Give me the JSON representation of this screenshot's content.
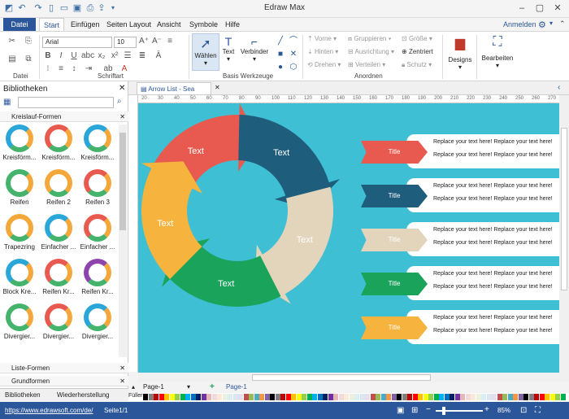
{
  "app": {
    "title": "Edraw Max"
  },
  "menu": {
    "tabs": [
      "Datei",
      "Start",
      "Einfügen",
      "Seiten Layout",
      "Ansicht",
      "Symbole",
      "Hilfe"
    ],
    "login": "Anmelden"
  },
  "ribbon": {
    "font_name": "Arial",
    "font_size": "10",
    "groups": {
      "file": "Datei",
      "font": "Schriftart",
      "tools": "Basis Werkzeuge",
      "arrange": "Anordnen"
    },
    "tools": {
      "select": "Wählen",
      "text": "Text",
      "connector": "Verbinder"
    },
    "arrange_items": [
      "Vorne",
      "Hinten",
      "Drehen",
      "Gruppieren",
      "Ausrichtung",
      "Verteilen",
      "Größe",
      "Zentriert",
      "Schutz"
    ],
    "designs": "Designs",
    "edit": "Bearbeiten"
  },
  "library": {
    "title": "Bibliotheken",
    "category1": "Kreislauf-Formen",
    "shapes": [
      {
        "label": "Kreisförm...",
        "color": "#2aa7d8"
      },
      {
        "label": "Kreisförm...",
        "color": "#e85a4f"
      },
      {
        "label": "Kreisförm...",
        "color": "#2aa7d8"
      },
      {
        "label": "Reifen",
        "color": "#45b36b"
      },
      {
        "label": "Reifen 2",
        "color": "#f4a73b"
      },
      {
        "label": "Reifen 3",
        "color": "#e85a4f"
      },
      {
        "label": "Trapezring",
        "color": "#f4a73b"
      },
      {
        "label": "Einfacher ...",
        "color": "#2aa7d8"
      },
      {
        "label": "Einfacher ...",
        "color": "#e85a4f"
      },
      {
        "label": "Block Kre...",
        "color": "#2aa7d8"
      },
      {
        "label": "Reifen Kr...",
        "color": "#e85a4f"
      },
      {
        "label": "Reifen Kr...",
        "color": "#8e44ad"
      },
      {
        "label": "Divergier...",
        "color": "#45b36b"
      },
      {
        "label": "Divergier...",
        "color": "#e85a4f"
      },
      {
        "label": "Divergier...",
        "color": "#2aa7d8"
      }
    ],
    "category2": "Liste-Formen",
    "category3": "Grundformen",
    "bottom_tabs": [
      "Bibliotheken",
      "Wiederherstellung"
    ]
  },
  "document": {
    "tab": "Arrow List - Sea"
  },
  "ruler": [
    "20",
    "30",
    "40",
    "50",
    "60",
    "70",
    "80",
    "90",
    "100",
    "110",
    "120",
    "130",
    "140",
    "150",
    "160",
    "170",
    "180",
    "190",
    "200",
    "210",
    "220",
    "230",
    "240",
    "250",
    "260",
    "270"
  ],
  "diagram": {
    "cycle_labels": [
      "Text",
      "Text",
      "Text",
      "Text",
      "Text"
    ],
    "cycle_colors": [
      "#e85a4f",
      "#1f5d7d",
      "#e3d4bc",
      "#1aa35a",
      "#f6b33e"
    ],
    "items": [
      {
        "title": "Title",
        "color": "#e85a4f",
        "line1": "Replace your text here!  Replace your text here!",
        "line2": "Replace your text here!  Replace your text here!"
      },
      {
        "title": "Title",
        "color": "#1f5d7d",
        "line1": "Replace your text here!  Replace your text here!",
        "line2": "Replace your text here!  Replace your text here!"
      },
      {
        "title": "Title",
        "color": "#e3d4bc",
        "line1": "Replace your text here!  Replace your text here!",
        "line2": "Replace your text here!  Replace your text here!"
      },
      {
        "title": "Title",
        "color": "#1aa35a",
        "line1": "Replace your text here!  Replace your text here!",
        "line2": "Replace your text here!  Replace your text here!"
      },
      {
        "title": "Title",
        "color": "#f6b33e",
        "line1": "Replace your text here!  Replace your text here!",
        "line2": "Replace your text here!  Replace your text here!"
      }
    ]
  },
  "pages": {
    "tab_left": "Page-1",
    "tab_right": "Page-1",
    "fill_label": "Füller"
  },
  "status": {
    "url": "https://www.edrawsoft.com/de/",
    "page": "Seite1/1",
    "zoom": "85%"
  }
}
